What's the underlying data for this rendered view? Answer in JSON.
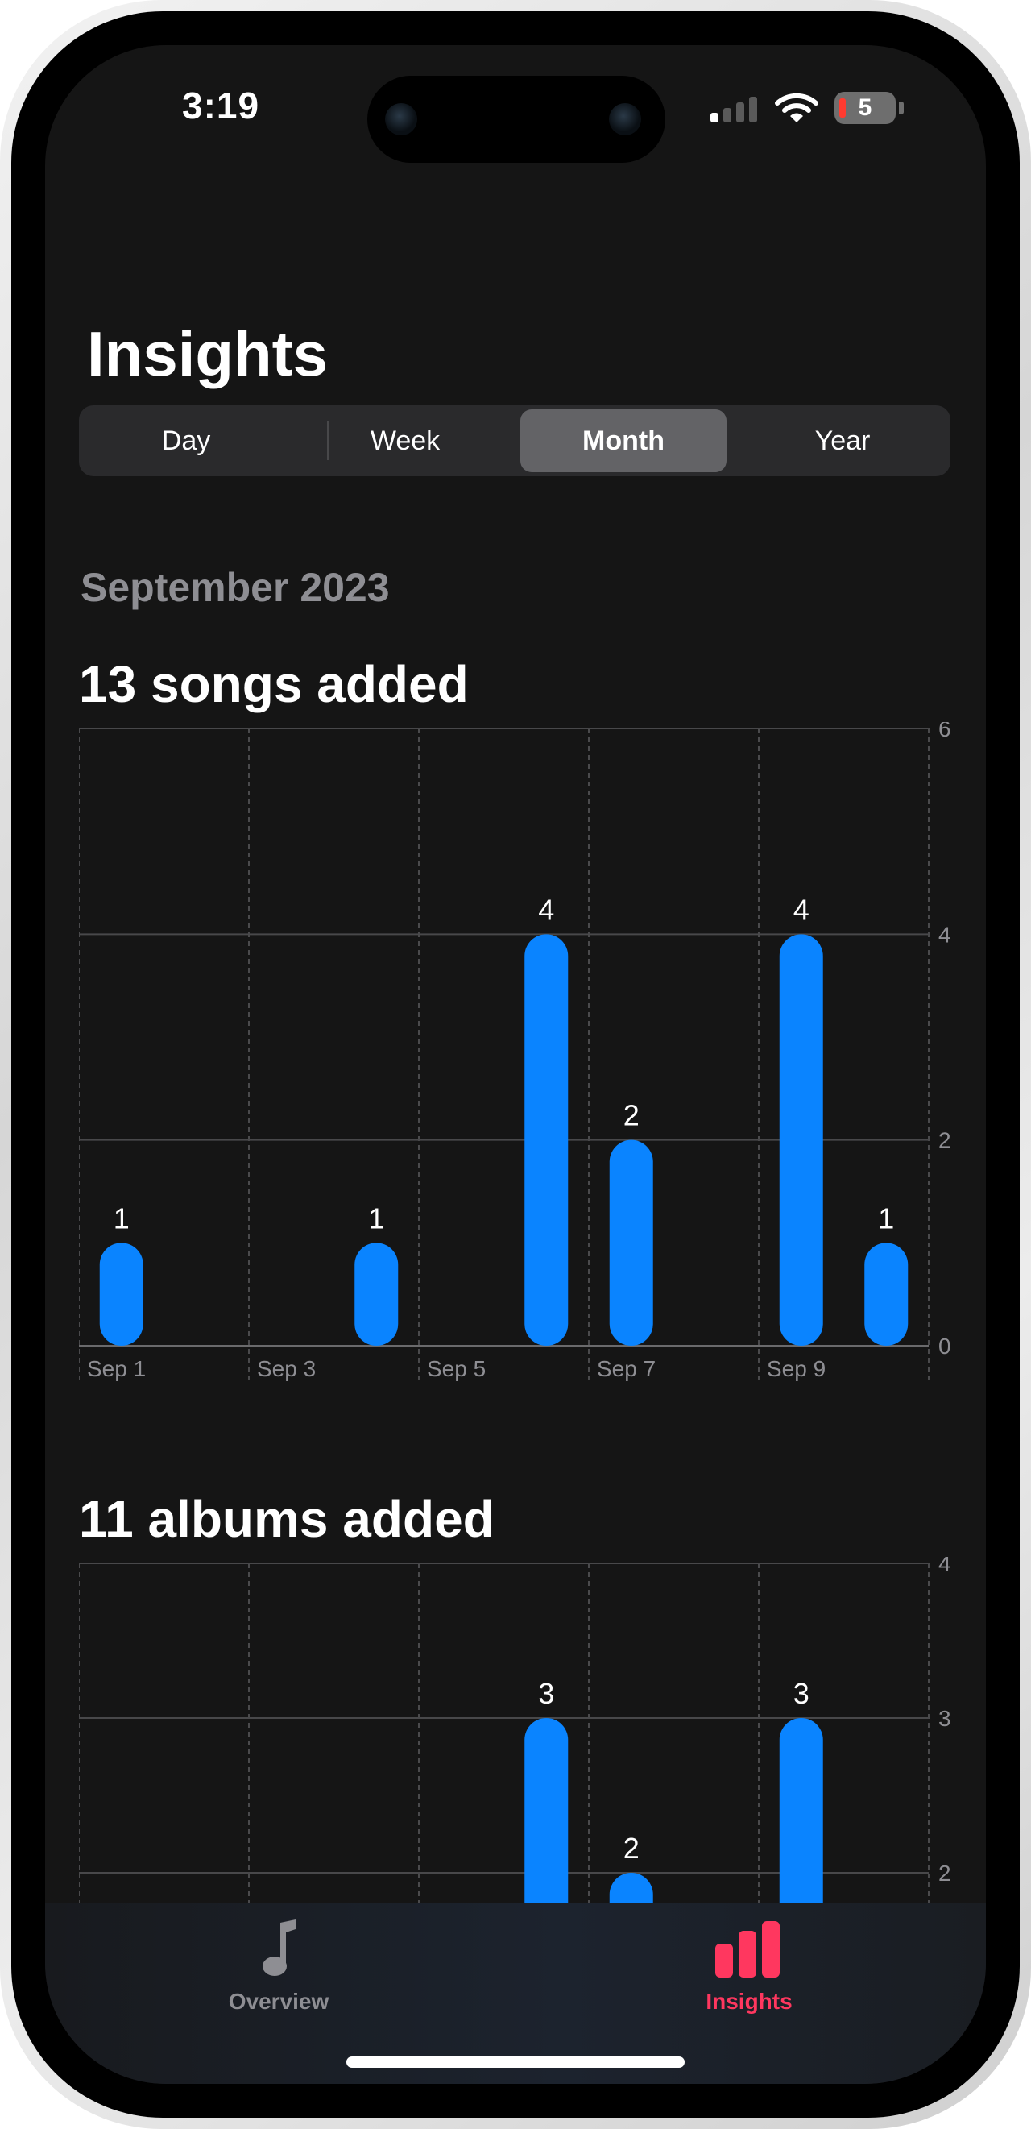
{
  "status": {
    "time": "3:19",
    "battery": "5"
  },
  "header": {
    "title": "Insights"
  },
  "segments": [
    {
      "label": "Day",
      "selected": false
    },
    {
      "label": "Week",
      "selected": false
    },
    {
      "label": "Month",
      "selected": true
    },
    {
      "label": "Year",
      "selected": false
    }
  ],
  "period": "September 2023",
  "charts": [
    {
      "title": "13 songs added"
    },
    {
      "title": "11 albums added"
    }
  ],
  "chart_data": [
    {
      "type": "bar",
      "title": "13 songs added",
      "x_ticks": [
        "Sep 1",
        "Sep 3",
        "Sep 5",
        "Sep 7",
        "Sep 9"
      ],
      "points": [
        {
          "day": 1,
          "value": 1
        },
        {
          "day": 4,
          "value": 1
        },
        {
          "day": 6,
          "value": 4
        },
        {
          "day": 7,
          "value": 2
        },
        {
          "day": 9,
          "value": 4
        },
        {
          "day": 10,
          "value": 1
        }
      ],
      "y_ticks": [
        0,
        2,
        4,
        6
      ],
      "ylim": [
        0,
        6
      ],
      "xlim": [
        1,
        11
      ],
      "grid": true,
      "bar_color": "#0a84ff"
    },
    {
      "type": "bar",
      "title": "11 albums added",
      "points": [
        {
          "day": 6,
          "value": 3
        },
        {
          "day": 7,
          "value": 2
        },
        {
          "day": 9,
          "value": 3
        }
      ],
      "y_ticks": [
        2,
        3,
        4
      ],
      "ylim": [
        0,
        4
      ],
      "xlim": [
        1,
        11
      ],
      "grid": true,
      "bar_color": "#0a84ff"
    }
  ],
  "tabs": [
    {
      "label": "Overview",
      "icon": "music-note-icon",
      "active": false
    },
    {
      "label": "Insights",
      "icon": "chart-bar-icon",
      "active": true
    }
  ],
  "colors": {
    "accent": "#ff375f",
    "bar": "#0a84ff"
  }
}
